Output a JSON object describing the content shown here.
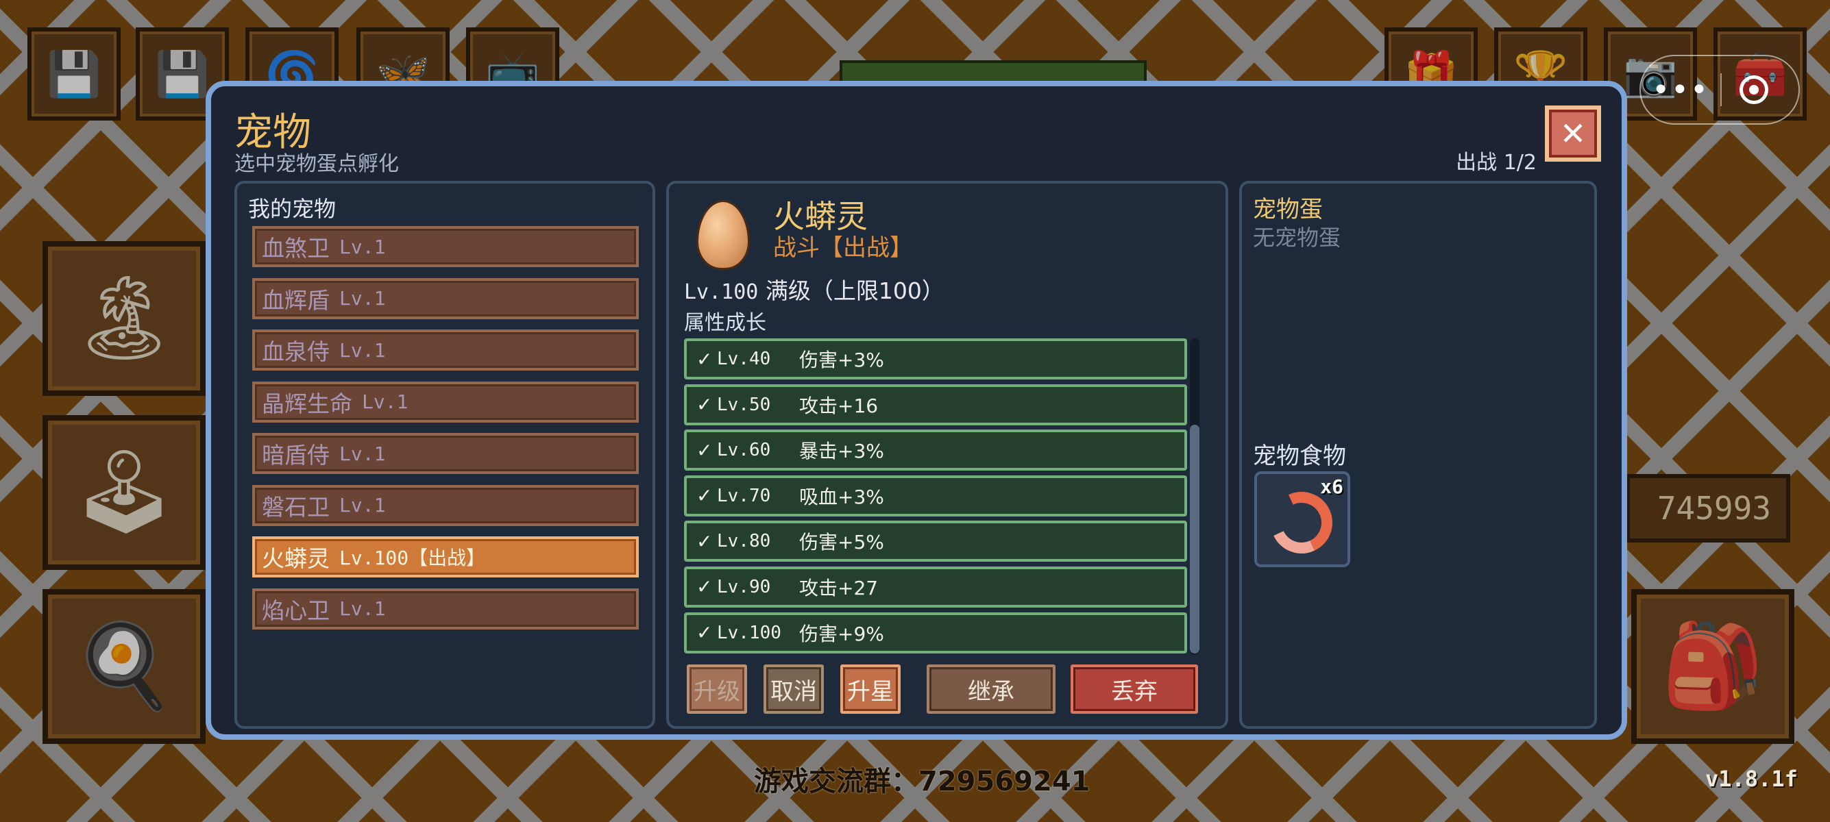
{
  "hud": {
    "gold_amount": "745993",
    "group_text": "游戏交流群：729569241",
    "version": "v1.8.1f"
  },
  "modal": {
    "title": "宠物",
    "subtitle": "选中宠物蛋点孵化",
    "deploy_count": "出战 1/2",
    "close_label": "✕"
  },
  "pets_panel": {
    "heading": "我的宠物",
    "items": [
      {
        "name": "血煞卫",
        "level": "Lv.1",
        "selected": false
      },
      {
        "name": "血辉盾",
        "level": "Lv.1",
        "selected": false
      },
      {
        "name": "血泉侍",
        "level": "Lv.1",
        "selected": false
      },
      {
        "name": "晶辉生命",
        "level": "Lv.1",
        "selected": false
      },
      {
        "name": "暗盾侍",
        "level": "Lv.1",
        "selected": false
      },
      {
        "name": "磐石卫",
        "level": "Lv.1",
        "selected": false
      },
      {
        "name": "火蟒灵",
        "level": "Lv.100【出战】",
        "selected": true
      },
      {
        "name": "焰心卫",
        "level": "Lv.1",
        "selected": false
      }
    ]
  },
  "detail_panel": {
    "pet_name": "火蟒灵",
    "pet_status": "战斗【出战】",
    "level_value": "Lv.100",
    "level_text": "满级（上限100）",
    "growth_heading": "属性成长",
    "growth": [
      {
        "check": "✓",
        "level": "Lv.40",
        "bonus": "伤害+3%"
      },
      {
        "check": "✓",
        "level": "Lv.50",
        "bonus": "攻击+16"
      },
      {
        "check": "✓",
        "level": "Lv.60",
        "bonus": "暴击+3%"
      },
      {
        "check": "✓",
        "level": "Lv.70",
        "bonus": "吸血+3%"
      },
      {
        "check": "✓",
        "level": "Lv.80",
        "bonus": "伤害+5%"
      },
      {
        "check": "✓",
        "level": "Lv.90",
        "bonus": "攻击+27"
      },
      {
        "check": "✓",
        "level": "Lv.100",
        "bonus": "伤害+9%"
      }
    ],
    "buttons": {
      "upgrade": "升级",
      "cancel": "取消",
      "star_up": "升星",
      "inherit": "继承",
      "discard": "丢弃"
    }
  },
  "eggs_panel": {
    "egg_heading": "宠物蛋",
    "egg_empty": "无宠物蛋",
    "food_heading": "宠物食物",
    "food_item": {
      "icon": "shrimp-icon",
      "count": "x6"
    }
  },
  "colors": {
    "modal_border": "#7ca2d8",
    "title_gold": "#f0c060",
    "selected_pet": "#d07a3a",
    "growth_row": "#24402c",
    "discard_red": "#b0443a"
  }
}
